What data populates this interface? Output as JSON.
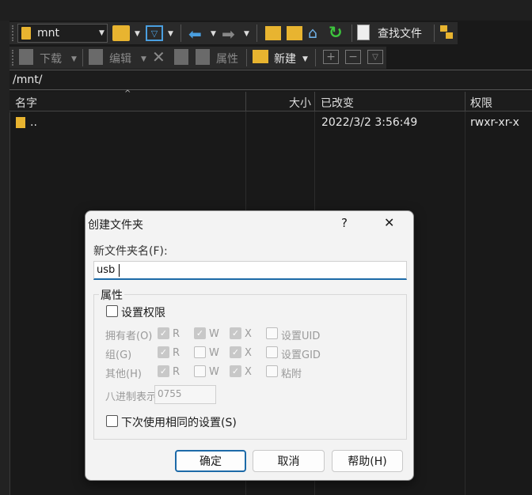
{
  "toolbar1": {
    "location_value": "mnt",
    "find_files_label": "查找文件"
  },
  "toolbar2": {
    "download_label": "下载",
    "edit_label": "编辑",
    "properties_label": "属性",
    "new_label": "新建"
  },
  "path": "/mnt/",
  "columns": {
    "name": "名字",
    "size": "大小",
    "changed": "已改变",
    "rights": "权限"
  },
  "rows": [
    {
      "name": "..",
      "size": "",
      "changed": "2022/3/2 3:56:49",
      "rights": "rwxr-xr-x"
    }
  ],
  "dialog": {
    "title": "创建文件夹",
    "help_icon": "?",
    "close_icon": "✕",
    "name_label": "新文件夹名(F):",
    "name_value": "usb",
    "attributes_group": "属性",
    "set_permissions": "设置权限",
    "owner_label": "拥有者(O)",
    "group_label": "组(G)",
    "others_label": "其他(H)",
    "r": "R",
    "w": "W",
    "x": "X",
    "set_uid": "设置UID",
    "set_gid": "设置GID",
    "sticky": "粘附",
    "octal_label": "八进制表示",
    "octal_value": "0755",
    "same_settings": "下次使用相同的设置(S)",
    "ok": "确定",
    "cancel": "取消",
    "help": "帮助(H)"
  }
}
